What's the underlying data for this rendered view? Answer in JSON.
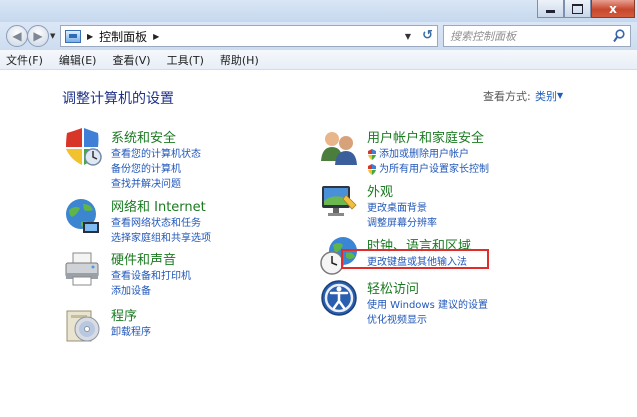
{
  "window": {
    "close_glyph": "x"
  },
  "address": {
    "crumb": "控制面板",
    "search_placeholder": "搜索控制面板"
  },
  "menu": [
    "文件(F)",
    "编辑(E)",
    "查看(V)",
    "工具(T)",
    "帮助(H)"
  ],
  "page": {
    "title": "调整计算机的设置",
    "view_by_label": "查看方式:",
    "view_by_value": "类别"
  },
  "categories": {
    "system": {
      "title": "系统和安全",
      "links": [
        "查看您的计算机状态",
        "备份您的计算机",
        "查找并解决问题"
      ]
    },
    "network": {
      "title": "网络和 Internet",
      "links": [
        "查看网络状态和任务",
        "选择家庭组和共享选项"
      ]
    },
    "hardware": {
      "title": "硬件和声音",
      "links": [
        "查看设备和打印机",
        "添加设备"
      ]
    },
    "programs": {
      "title": "程序",
      "links": [
        "卸载程序"
      ]
    },
    "users": {
      "title": "用户帐户和家庭安全",
      "links": [
        "添加或删除用户帐户",
        "为所有用户设置家长控制"
      ]
    },
    "appearance": {
      "title": "外观",
      "links": [
        "更改桌面背景",
        "调整屏幕分辨率"
      ]
    },
    "clock": {
      "title": "时钟、语言和区域",
      "links": [
        "更改键盘或其他输入法"
      ]
    },
    "ease": {
      "title": "轻松访问",
      "links": [
        "使用 Windows 建议的设置",
        "优化视频显示"
      ]
    }
  },
  "colors": {
    "category_title": "#1a7a21",
    "link": "#2157b9",
    "page_title": "#1e3287",
    "highlight_box": "#e22b2b"
  }
}
